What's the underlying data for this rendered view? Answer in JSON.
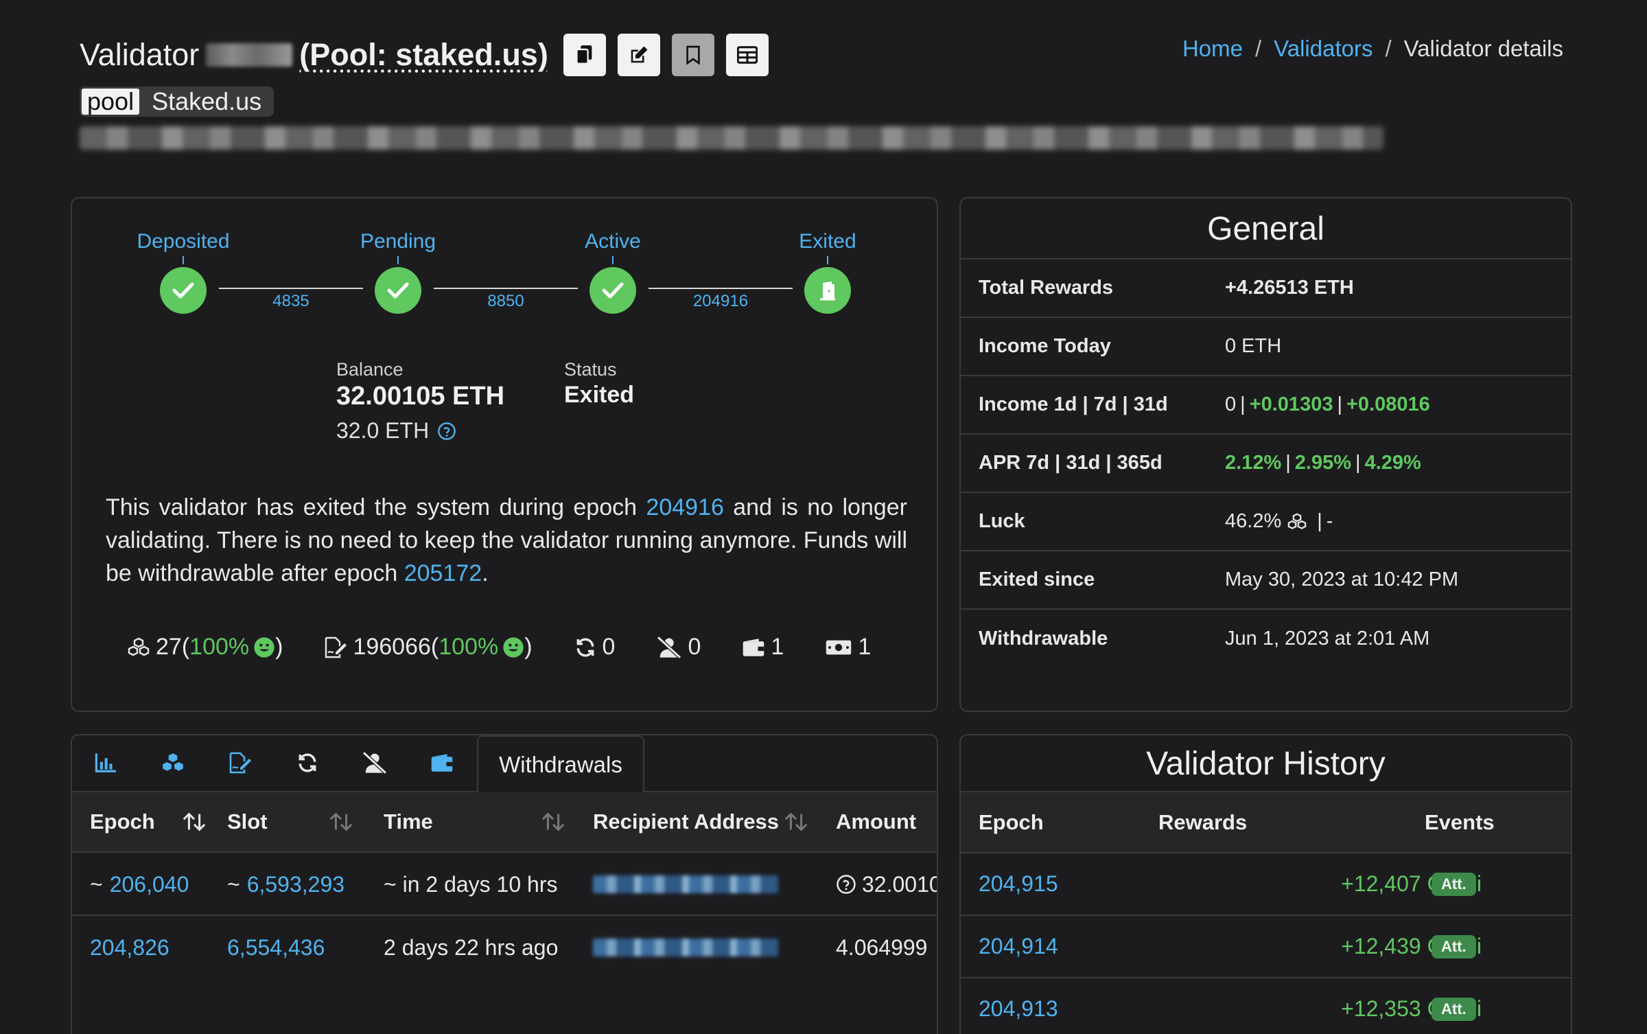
{
  "header": {
    "title_prefix": "Validator",
    "pool_label": "(Pool: staked.us)",
    "pool_badge_tag": "pool",
    "pool_badge_name": "Staked.us"
  },
  "breadcrumb": [
    "Home",
    "/",
    "Validators",
    "/",
    "Validator details"
  ],
  "lifecycle": {
    "steps": [
      "Deposited",
      "Pending",
      "Active",
      "Exited"
    ],
    "gaps": [
      "4835",
      "8850",
      "204916"
    ]
  },
  "balance": {
    "label": "Balance",
    "value": "32.00105 ETH",
    "effective": "32.0 ETH"
  },
  "status": {
    "label": "Status",
    "value": "Exited"
  },
  "exit_message": {
    "part1": "This validator has exited the system during epoch ",
    "exit_epoch": "204916",
    "part2": " and is no longer validating. There is no need to keep the validator running anymore. Funds will be withdrawable after epoch ",
    "withdraw_epoch": "205172",
    "part3": "."
  },
  "stats": {
    "proposals": "27",
    "proposals_pct": "100%",
    "attestations": "196066",
    "attestations_pct": "100%",
    "sync": "0",
    "slashings": "0",
    "deposits": "1",
    "withdrawals": "1"
  },
  "general": {
    "title": "General",
    "rows": {
      "total_rewards": {
        "k": "Total Rewards",
        "v": "+4.26513 ETH"
      },
      "income_today": {
        "k": "Income Today",
        "v": "0 ETH"
      },
      "income_periods": {
        "k": "Income 1d | 7d | 31d",
        "v1": "0",
        "v2": "+0.01303",
        "v3": "+0.08016"
      },
      "apr": {
        "k": "APR 7d | 31d | 365d",
        "v1": "2.12%",
        "v2": "2.95%",
        "v3": "4.29%"
      },
      "luck": {
        "k": "Luck",
        "v": "46.2%",
        "v2": "-"
      },
      "exited_since": {
        "k": "Exited since",
        "v": "May 30, 2023 at 10:42 PM"
      },
      "withdrawable": {
        "k": "Withdrawable",
        "v": "Jun 1, 2023 at 2:01 AM"
      }
    }
  },
  "withdrawals": {
    "active_tab": "Withdrawals",
    "columns": [
      "Epoch",
      "Slot",
      "Time",
      "Recipient Address",
      "Amount"
    ],
    "rows": [
      {
        "epoch_prefix": "~ ",
        "epoch": "206,040",
        "slot_prefix": "~ ",
        "slot": "6,593,293",
        "time": "~ in 2 days 10 hrs",
        "amount": "32.0010"
      },
      {
        "epoch_prefix": "",
        "epoch": "204,826",
        "slot_prefix": "",
        "slot": "6,554,436",
        "time": "2 days 22 hrs ago",
        "amount": "4.064999"
      }
    ]
  },
  "history": {
    "title": "Validator History",
    "columns": [
      "Epoch",
      "Rewards",
      "Events"
    ],
    "rows": [
      {
        "epoch": "204,915",
        "rewards": "+12,407 GWei",
        "event": "Att."
      },
      {
        "epoch": "204,914",
        "rewards": "+12,439 GWei",
        "event": "Att."
      },
      {
        "epoch": "204,913",
        "rewards": "+12,353 GWei",
        "event": "Att."
      }
    ]
  },
  "colors": {
    "background": "#1c1c1e",
    "accent_link": "#4fb3f0",
    "positive": "#5fc85f",
    "border": "#3a3a3c"
  }
}
